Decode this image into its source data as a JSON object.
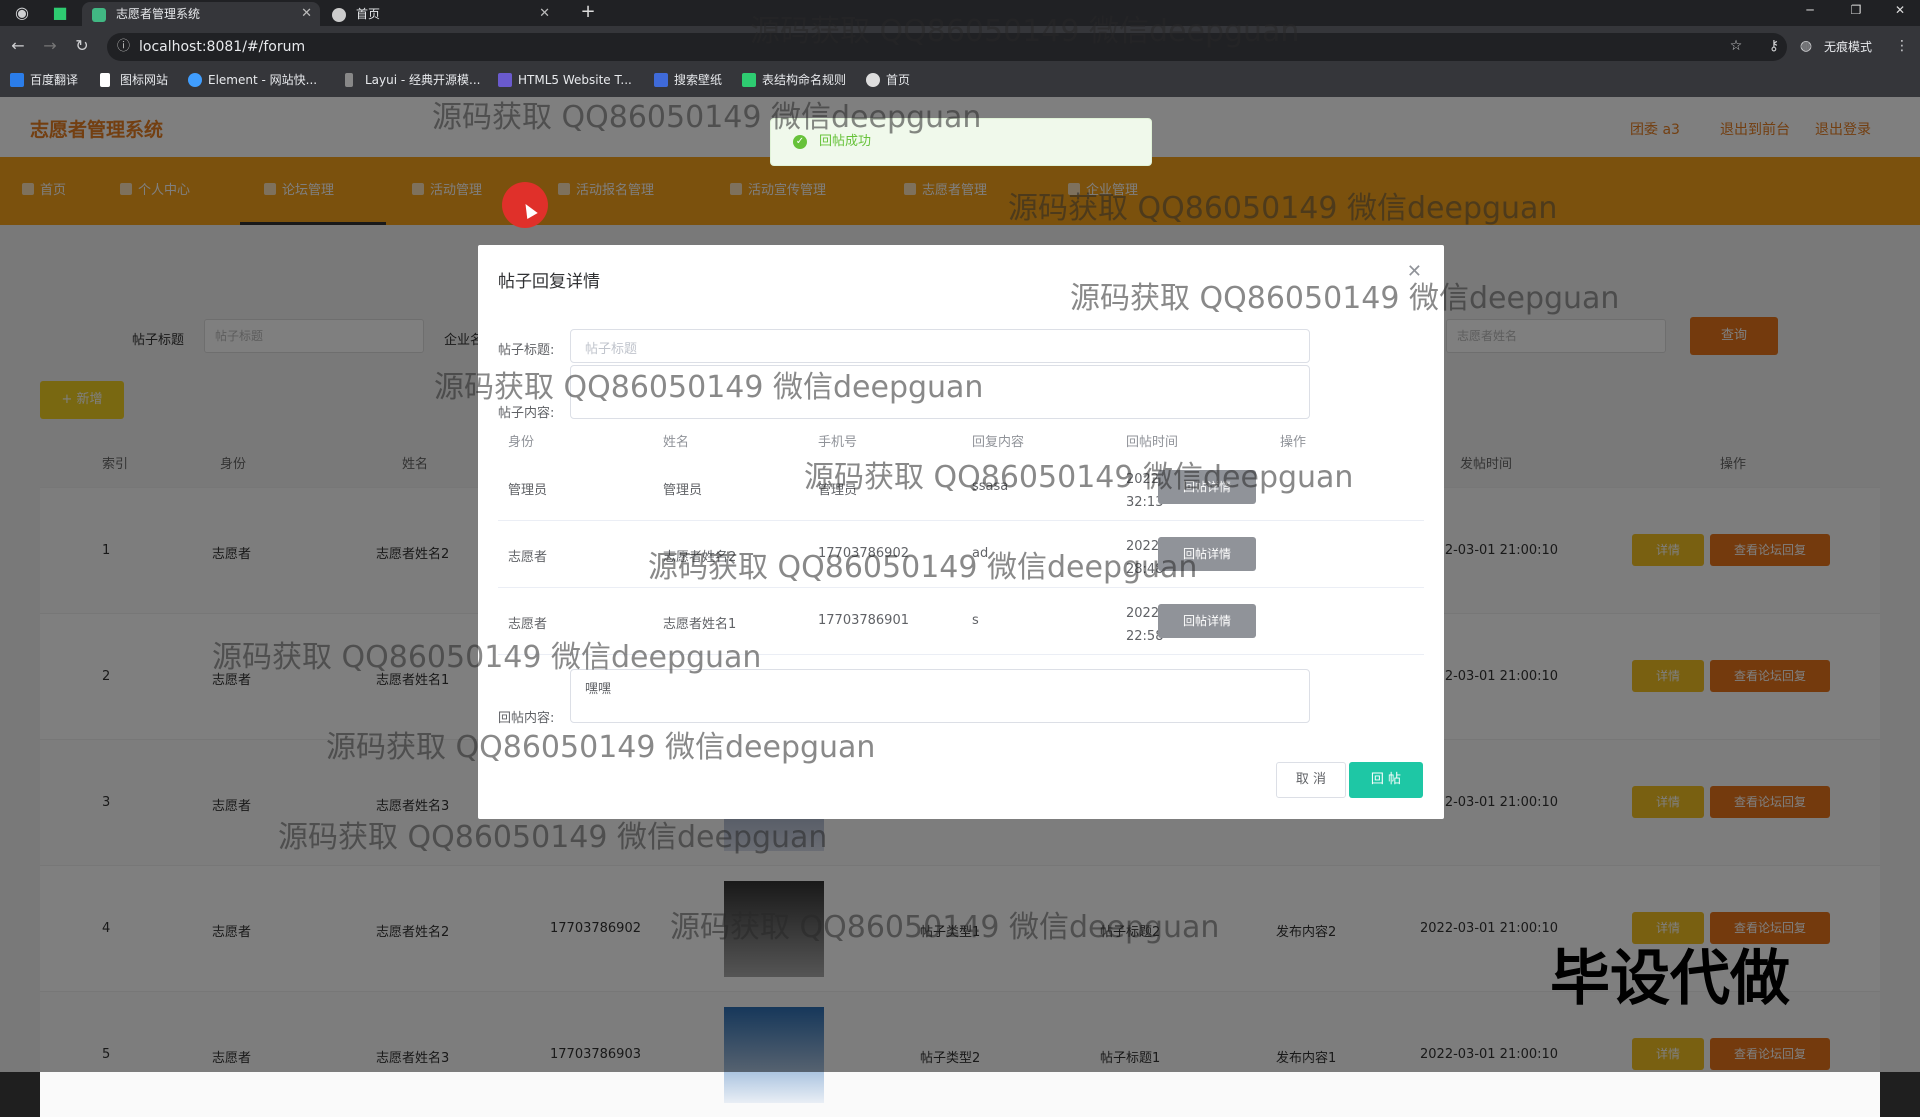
{
  "browser": {
    "tabs": [
      {
        "title": "志愿者管理系统",
        "active": true
      },
      {
        "title": "首页",
        "active": false
      }
    ],
    "url": "localhost:8081/#/forum",
    "profile": "无痕模式",
    "bookmarks": [
      "百度翻译",
      "图标网站",
      "Element - 网站快...",
      "Layui - 经典开源模...",
      "HTML5 Website T...",
      "搜索壁纸",
      "表结构命名规则",
      "首页"
    ]
  },
  "app": {
    "logo": "志愿者管理系统",
    "top_right": [
      "团委 a3",
      "退出到前台",
      "退出登录"
    ],
    "nav": [
      "首页",
      "个人中心",
      "论坛管理",
      "活动管理",
      "活动报名管理",
      "活动宣传管理",
      "志愿者管理",
      "企业管理"
    ],
    "search": {
      "title_label": "帖子标题",
      "title_placeholder": "帖子标题",
      "company_label": "企业名",
      "volunteer_placeholder": "志愿者姓名",
      "query_label": "查询"
    },
    "add_label": "+ 新增",
    "table": {
      "headers": [
        "索引",
        "身份",
        "姓名",
        "手机号",
        "",
        "帖子类型",
        "帖子标题",
        "发布内容",
        "发帖时间",
        "操作"
      ],
      "rows": [
        {
          "index": "1",
          "role": "志愿者",
          "name": "志愿者姓名2",
          "phone": "",
          "type": "",
          "title": "",
          "content": "",
          "time": "2022-03-01 21:00:10"
        },
        {
          "index": "2",
          "role": "志愿者",
          "name": "志愿者姓名1",
          "phone": "",
          "type": "",
          "title": "",
          "content": "",
          "time": "2022-03-01 21:00:10"
        },
        {
          "index": "3",
          "role": "志愿者",
          "name": "志愿者姓名3",
          "phone": "",
          "type": "",
          "title": "",
          "content": "",
          "time": "2022-03-01 21:00:10"
        },
        {
          "index": "4",
          "role": "志愿者",
          "name": "志愿者姓名2",
          "phone": "17703786902",
          "type": "帖子类型1",
          "title": "帖子标题2",
          "content": "发布内容2",
          "time": "2022-03-01 21:00:10"
        },
        {
          "index": "5",
          "role": "志愿者",
          "name": "志愿者姓名3",
          "phone": "17703786903",
          "type": "帖子类型2",
          "title": "帖子标题1",
          "content": "发布内容1",
          "time": "2022-03-01 21:00:10"
        }
      ],
      "detail_label": "详情",
      "view_label": "查看论坛回复"
    }
  },
  "dialog": {
    "title": "帖子回复详情",
    "post_title_label": "帖子标题:",
    "post_title_placeholder": "帖子标题",
    "post_content_label": "帖子内容:",
    "reply_headers": [
      "身份",
      "姓名",
      "手机号",
      "回复内容",
      "回帖时间",
      "操作"
    ],
    "replies": [
      {
        "role": "管理员",
        "name": "管理员",
        "phone": "管理员",
        "content": "ssasa",
        "time": "2022-03-02 09:32:13"
      },
      {
        "role": "志愿者",
        "name": "志愿者姓名2",
        "phone": "17703786902",
        "content": "ad",
        "time": "2022-03-02 09:28:48"
      },
      {
        "role": "志愿者",
        "name": "志愿者姓名1",
        "phone": "17703786901",
        "content": "s",
        "time": "2022-03-01 21:22:58"
      }
    ],
    "reply_detail_label": "回帖详情",
    "reply_content_label": "回帖内容:",
    "reply_content_value": "嘿嘿",
    "cancel_label": "取 消",
    "submit_label": "回 帖"
  },
  "toast": {
    "message": "回帖成功"
  },
  "watermark": "源码获取 QQ86050149 微信deepguan",
  "corner_text": "毕设代做"
}
